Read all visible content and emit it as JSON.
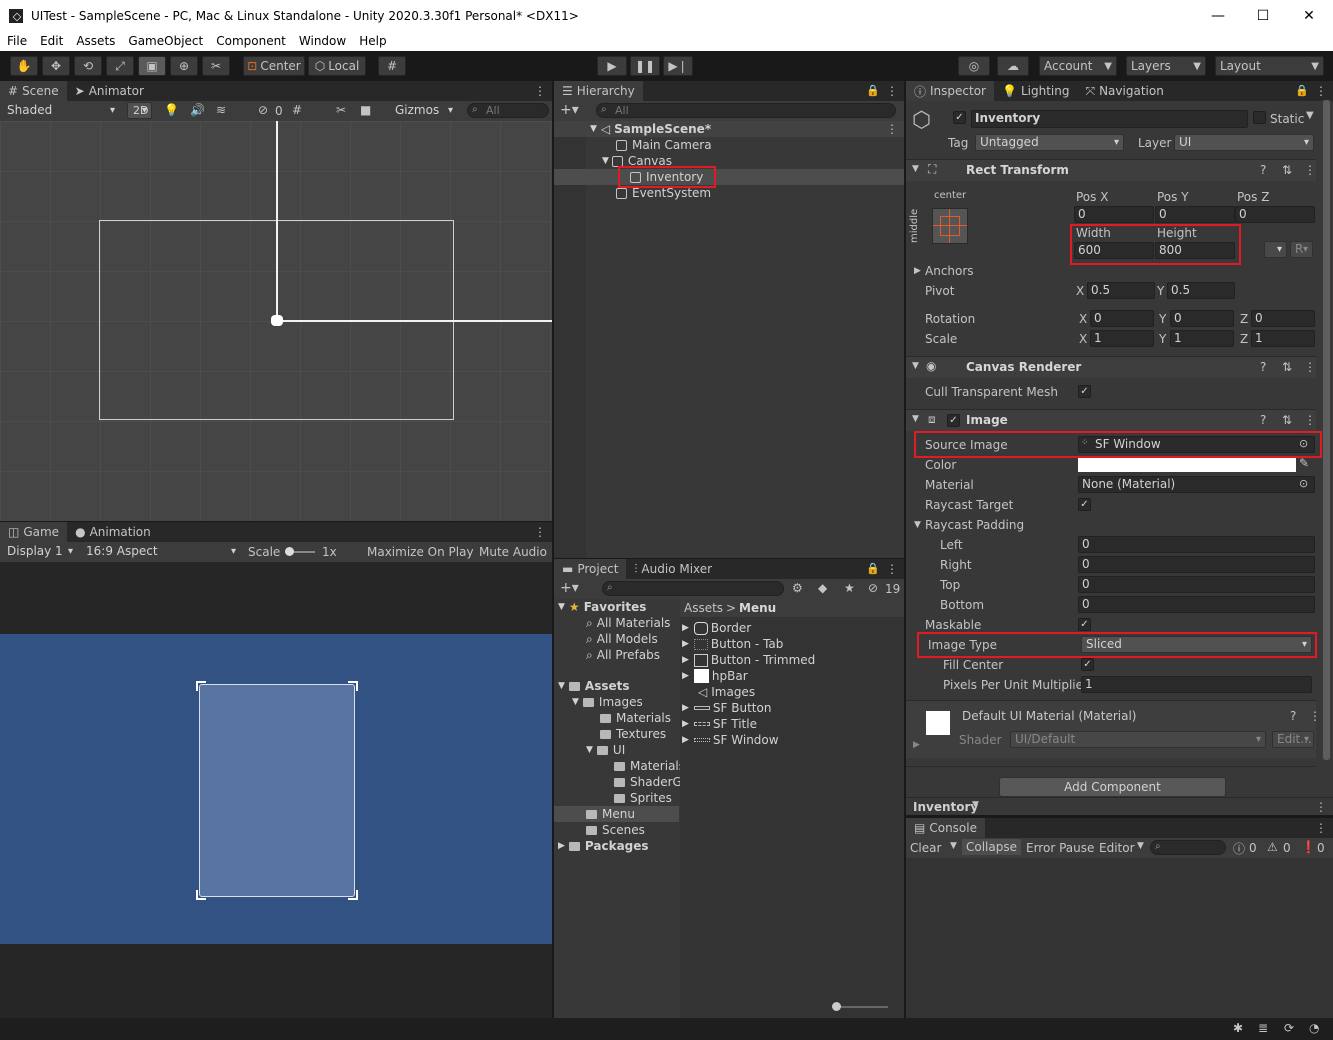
{
  "window": {
    "title": "UITest - SampleScene - PC, Mac & Linux Standalone - Unity 2020.3.30f1 Personal* <DX11>",
    "minimize": "—",
    "maximize": "☐",
    "close": "✕"
  },
  "menu": [
    "File",
    "Edit",
    "Assets",
    "GameObject",
    "Component",
    "Window",
    "Help"
  ],
  "toolbar": {
    "center": "Center",
    "local": "Local",
    "account": "Account",
    "layers": "Layers",
    "layout": "Layout"
  },
  "scene": {
    "tab_scene": "Scene",
    "tab_animator": "Animator",
    "shading": "Shaded",
    "mode_2d": "2D",
    "gizmos": "Gizmos",
    "search_placeholder": "All",
    "hidden_count": "0"
  },
  "game": {
    "tab_game": "Game",
    "tab_animation": "Animation",
    "display": "Display 1",
    "aspect": "16:9 Aspect",
    "scale_label": "Scale",
    "scale_value": "1x",
    "maximize": "Maximize On Play",
    "mute": "Mute Audio"
  },
  "hierarchy": {
    "tab": "Hierarchy",
    "search_placeholder": "All",
    "scene": "SampleScene*",
    "items": [
      "Main Camera",
      "Canvas",
      "Inventory",
      "EventSystem"
    ]
  },
  "project": {
    "tab_project": "Project",
    "tab_audio": "Audio Mixer",
    "hidden_count": "19",
    "favorites": "Favorites",
    "fav_items": [
      "All Materials",
      "All Models",
      "All Prefabs"
    ],
    "assets": "Assets",
    "tree": [
      "Images",
      "Materials",
      "Textures",
      "UI",
      "Materials",
      "ShaderG",
      "Sprites",
      "Menu",
      "Scenes"
    ],
    "packages": "Packages",
    "breadcrumb_root": "Assets",
    "breadcrumb_leaf": "Menu",
    "files": [
      "Border",
      "Button - Tab",
      "Button - Trimmed",
      "hpBar",
      "Images",
      "SF Button",
      "SF Title",
      "SF Window"
    ]
  },
  "inspector": {
    "tab_inspector": "Inspector",
    "tab_lighting": "Lighting",
    "tab_navigation": "Navigation",
    "object_name": "Inventory",
    "static_label": "Static",
    "tag_label": "Tag",
    "tag_value": "Untagged",
    "layer_label": "Layer",
    "layer_value": "UI",
    "rect": {
      "title": "Rect Transform",
      "anchor_h": "center",
      "anchor_v": "middle",
      "posx_label": "Pos X",
      "posy_label": "Pos Y",
      "posz_label": "Pos Z",
      "posx": "0",
      "posy": "0",
      "posz": "0",
      "width_label": "Width",
      "height_label": "Height",
      "width": "600",
      "height": "800",
      "r_btn": "R",
      "anchors": "Anchors",
      "pivot": "Pivot",
      "pivot_x": "0.5",
      "pivot_y": "0.5",
      "rotation": "Rotation",
      "rot_x": "0",
      "rot_y": "0",
      "rot_z": "0",
      "scale": "Scale",
      "scale_x": "1",
      "scale_y": "1",
      "scale_z": "1",
      "x": "X",
      "y": "Y",
      "z": "Z"
    },
    "canvas_renderer": {
      "title": "Canvas Renderer",
      "cull": "Cull Transparent Mesh"
    },
    "image": {
      "title": "Image",
      "source_label": "Source Image",
      "source_value": "SF Window",
      "color_label": "Color",
      "material_label": "Material",
      "material_value": "None (Material)",
      "raycast_target": "Raycast Target",
      "raycast_padding": "Raycast Padding",
      "left": "Left",
      "right": "Right",
      "top": "Top",
      "bottom": "Bottom",
      "left_v": "0",
      "right_v": "0",
      "top_v": "0",
      "bottom_v": "0",
      "maskable": "Maskable",
      "image_type_label": "Image Type",
      "image_type_value": "Sliced",
      "fill_center": "Fill Center",
      "ppu_label": "Pixels Per Unit Multiplier",
      "ppu_value": "1"
    },
    "material": {
      "title": "Default UI Material (Material)",
      "shader_label": "Shader",
      "shader_value": "UI/Default",
      "edit": "Edit..."
    },
    "add_component": "Add Component",
    "footer_label": "Inventory"
  },
  "console": {
    "tab": "Console",
    "clear": "Clear",
    "collapse": "Collapse",
    "error_pause": "Error Pause",
    "editor": "Editor",
    "info_count": "0",
    "warn_count": "0",
    "error_count": "0"
  }
}
